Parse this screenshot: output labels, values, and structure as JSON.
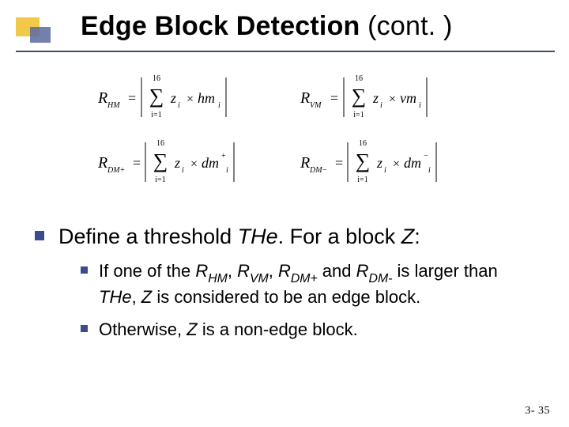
{
  "title": {
    "bold": "Edge Block Detection",
    "cont": " (cont. )"
  },
  "formulas": {
    "r_hm": {
      "lhs_R": "R",
      "lhs_sub": "HM",
      "eq": "=",
      "sumTop": "16",
      "sumBot": "i=1",
      "z": "z",
      "z_sub": "i",
      "times": "×",
      "rhs": "hm",
      "rhs_sub": "i",
      "sup": ""
    },
    "r_vm": {
      "lhs_R": "R",
      "lhs_sub": "VM",
      "eq": "=",
      "sumTop": "16",
      "sumBot": "i=1",
      "z": "z",
      "z_sub": "i",
      "times": "×",
      "rhs": "vm",
      "rhs_sub": "i",
      "sup": ""
    },
    "r_dmp": {
      "lhs_R": "R",
      "lhs_sub": "DM+",
      "eq": "=",
      "sumTop": "16",
      "sumBot": "i=1",
      "z": "z",
      "z_sub": "i",
      "times": "×",
      "rhs": "dm",
      "rhs_sub": "i",
      "sup": "+"
    },
    "r_dmm": {
      "lhs_R": "R",
      "lhs_sub": "DM−",
      "eq": "=",
      "sumTop": "16",
      "sumBot": "i=1",
      "z": "z",
      "z_sub": "i",
      "times": "×",
      "rhs": "dm",
      "rhs_sub": "i",
      "sup": "−"
    }
  },
  "bullets": {
    "lvl1": {
      "pre": "Define a threshold ",
      "it1": "THe",
      "mid": ". For a block ",
      "it2": "Z",
      "post": ":"
    },
    "sub1": {
      "a": "If one of the ",
      "r": "R",
      "s1": "HM",
      "c1": ", ",
      "s2": "VM",
      "c2": ", ",
      "s3": "DM+",
      "c3": " and ",
      "s4": "DM-",
      "b": " is larger than ",
      "the": "THe",
      "c": ", ",
      "z": "Z",
      "d": " is considered to be an edge block."
    },
    "sub2": {
      "a": "Otherwise, ",
      "z": "Z",
      "b": " is a non-edge block."
    }
  },
  "pageNumber": "3- 35"
}
